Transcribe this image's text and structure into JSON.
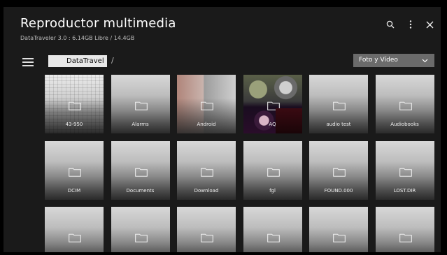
{
  "app": {
    "title": "Reproductor multimedia",
    "subtitle": "DataTraveler 3.0 : 6.14GB Libre / 14.4GB"
  },
  "top_icons": [
    "search-icon",
    "more-vertical-icon",
    "close-icon"
  ],
  "path": {
    "current": "DataTravel",
    "separator": "/"
  },
  "filter": {
    "selected": "Foto y Vídeo"
  },
  "items": [
    {
      "label": "43-950",
      "thumb": "thumb-43"
    },
    {
      "label": "Alarms",
      "thumb": ""
    },
    {
      "label": "Android",
      "thumb": "thumb-android"
    },
    {
      "label": "AQ",
      "thumb": "thumb-aq"
    },
    {
      "label": "audio test",
      "thumb": ""
    },
    {
      "label": "Audiobooks",
      "thumb": ""
    },
    {
      "label": "DCIM",
      "thumb": ""
    },
    {
      "label": "Documents",
      "thumb": ""
    },
    {
      "label": "Download",
      "thumb": ""
    },
    {
      "label": "fgl",
      "thumb": ""
    },
    {
      "label": "FOUND.000",
      "thumb": ""
    },
    {
      "label": "LOST.DIR",
      "thumb": ""
    },
    {
      "label": "",
      "thumb": ""
    },
    {
      "label": "",
      "thumb": ""
    },
    {
      "label": "",
      "thumb": ""
    },
    {
      "label": "",
      "thumb": ""
    },
    {
      "label": "",
      "thumb": ""
    },
    {
      "label": "",
      "thumb": ""
    }
  ]
}
